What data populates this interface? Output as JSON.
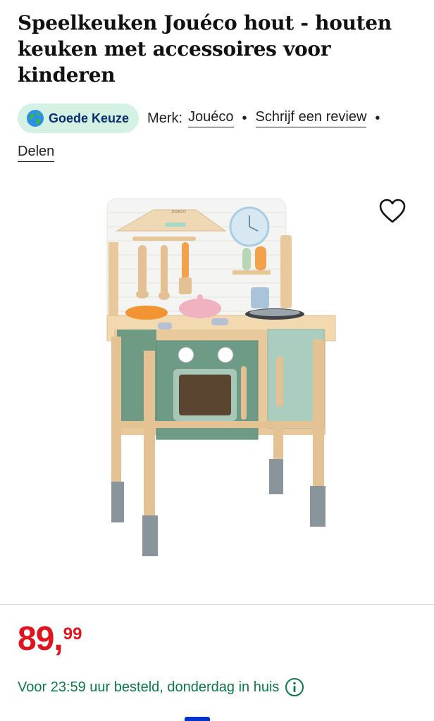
{
  "product": {
    "title": "Speelkeuken Jouéco hout - houten keuken met accessoires voor kinderen",
    "badge_label": "Goede Keuze",
    "brand_prefix": "Merk:",
    "brand_name": "Jouéco",
    "review_link": "Schrijf een review",
    "share_link": "Delen",
    "separator": "•",
    "image_label": "JOUECO"
  },
  "price": {
    "whole": "89,",
    "cents": "99"
  },
  "delivery": {
    "text": "Voor 23:59 uur besteld, donderdag in huis"
  },
  "icons": {
    "badge": "globe-icon",
    "favorite": "heart-icon",
    "info": "info-icon"
  },
  "colors": {
    "price": "#e0141e",
    "delivery": "#0a7a45",
    "badge_bg": "#d3f2e3",
    "badge_text": "#0a2d6e",
    "accent": "#0033cc"
  }
}
